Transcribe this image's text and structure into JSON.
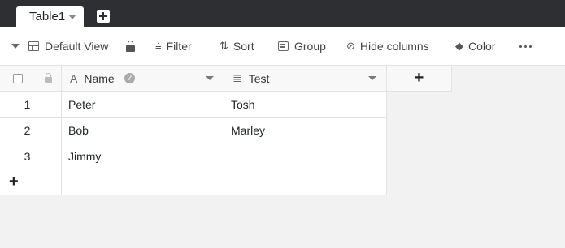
{
  "tabs": [
    {
      "label": "Table1"
    }
  ],
  "toolbar": {
    "view_label": "Default View",
    "filter_label": "Filter",
    "sort_label": "Sort",
    "group_label": "Group",
    "hide_columns_label": "Hide columns",
    "color_label": "Color"
  },
  "columns": [
    {
      "name": "Name",
      "type_icon": "text-type-icon"
    },
    {
      "name": "Test",
      "type_icon": "long-text-type-icon"
    }
  ],
  "rows": [
    {
      "num": "1",
      "name": "Peter",
      "test": "Tosh"
    },
    {
      "num": "2",
      "name": "Bob",
      "test": "Marley"
    },
    {
      "num": "3",
      "name": "Jimmy",
      "test": ""
    }
  ],
  "add_row_label": "+",
  "add_column_label": "+",
  "help_glyph": "?"
}
